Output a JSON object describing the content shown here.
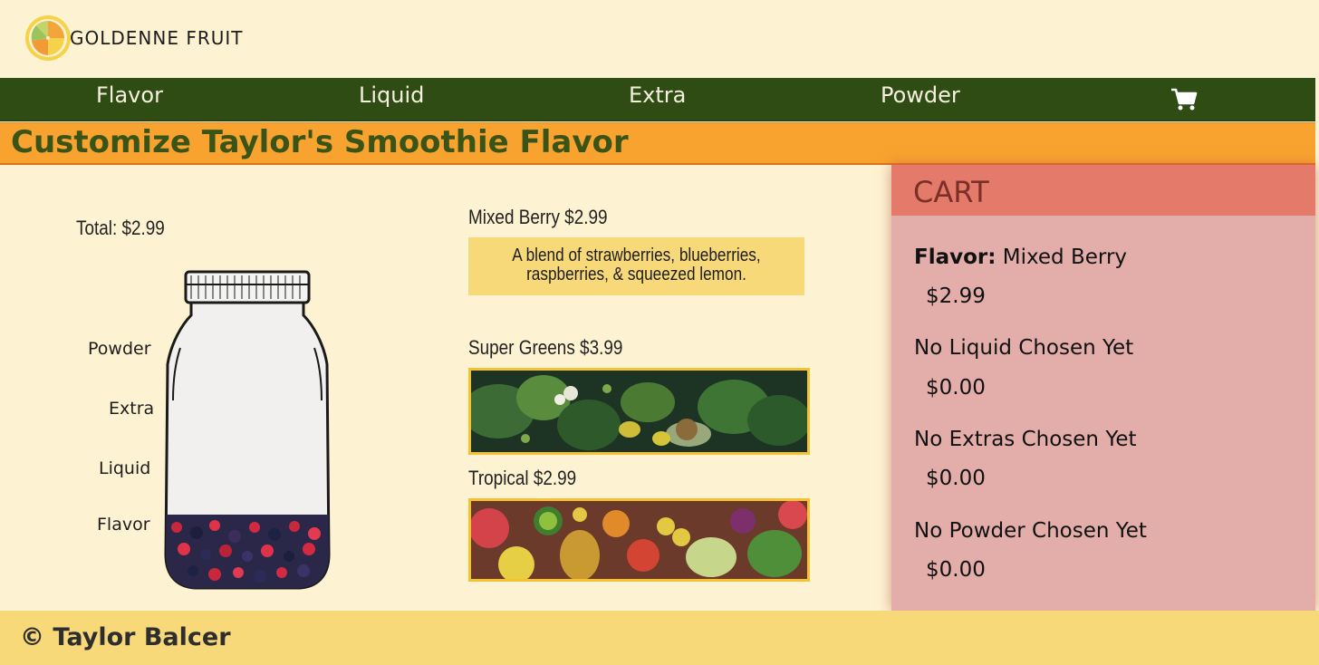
{
  "brand": {
    "name": "GOLDENNE FRUIT",
    "logo_icon": "citrus-slice-icon",
    "colors": {
      "orange": "#f4a53a",
      "green": "#9bc45d",
      "yellow": "#f6d24a"
    }
  },
  "nav": {
    "items": [
      "Flavor",
      "Liquid",
      "Extra",
      "Powder"
    ],
    "cart_icon": "shopping-cart-icon",
    "background": "#2f4c15"
  },
  "page": {
    "title": "Customize Taylor's Smoothie Flavor"
  },
  "builder": {
    "total_label": "Total: $2.99",
    "jar_layers": [
      "Powder",
      "Extra",
      "Liquid",
      "Flavor"
    ],
    "jar_filled_layer": "Flavor"
  },
  "options": [
    {
      "title": "Mixed Berry $2.99",
      "description": "A blend of strawberries, blueberries, raspberries, & squeezed lemon.",
      "selected": true
    },
    {
      "title": "Super Greens $3.99",
      "image": "leafy-greens-photo"
    },
    {
      "title": "Tropical $2.99",
      "image": "tropical-fruits-photo"
    }
  ],
  "cart": {
    "title": "CART",
    "flavor_label": "Flavor:",
    "flavor_value": "Mixed Berry",
    "flavor_price": "$2.99",
    "liquid": "No Liquid Chosen Yet",
    "liquid_price": "$0.00",
    "extras": "No Extras Chosen Yet",
    "extras_price": "$0.00",
    "powder": "No Powder Chosen Yet",
    "powder_price": "$0.00"
  },
  "footer": {
    "copyright": "© Taylor Balcer"
  }
}
